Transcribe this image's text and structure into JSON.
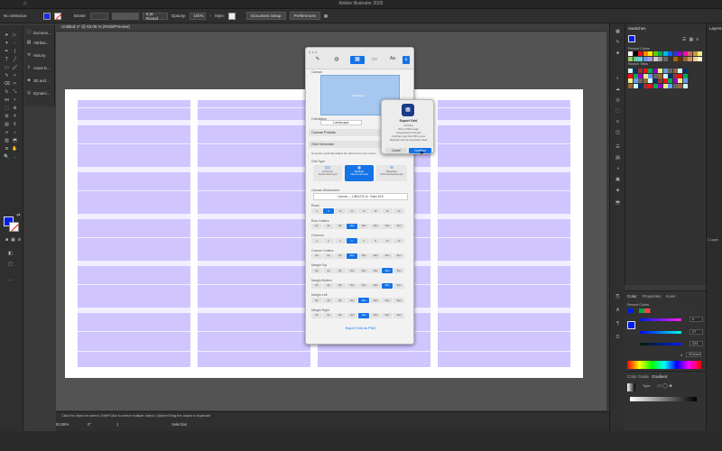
{
  "app": {
    "title": "Adobe Illustrator 2025"
  },
  "control_bar": {
    "selection": "No Selection",
    "stroke_label": "Stroke:",
    "brush": "5 pt. Round",
    "opacity_label": "Opacity:",
    "opacity_value": "100%",
    "style_label": "Style:",
    "document_setup": "Document Setup",
    "preferences": "Preferences"
  },
  "left_panels": {
    "items": [
      "Docume...",
      "Attribut...",
      "History",
      "Asset E...",
      "3D and ...",
      "Dynami..."
    ]
  },
  "document": {
    "tab": "Untitled-1* @ 83.06 % (RGB/Preview)"
  },
  "plugin": {
    "preview_text": "Grid Setup",
    "canvas_label": "Canvas",
    "orientation_label": "Orientation",
    "orientation_value": "Landscape",
    "canvas_presets": "Canvas Presets",
    "grid_generator": "Grid Generator",
    "grid_desc": "Generate a grid that adapts the document to any screen",
    "grid_type_label": "Grid Type",
    "grid_types": [
      {
        "title": "Columns",
        "desc": "Vertical column grid"
      },
      {
        "title": "Modular",
        "desc": "Columns and rows"
      },
      {
        "title": "Baseline",
        "desc": "Horizontal baseline grid"
      }
    ],
    "canvas_dims_label": "Canvas Dimensions",
    "canvas_dims": "Canvas — 1280x720 pt · Ratio 16:9",
    "sections": [
      {
        "label": "Rows",
        "values": [
          "6",
          "8",
          "10",
          "12",
          "14",
          "16",
          "18",
          "20"
        ],
        "selected": 1
      },
      {
        "label": "Row Gutters",
        "values": [
          "0pt",
          "4pt",
          "8pt",
          "12pt",
          "16pt",
          "20pt",
          "24pt",
          "32pt"
        ],
        "selected": 3
      },
      {
        "label": "Columns",
        "values": [
          "2",
          "3",
          "4",
          "5",
          "6",
          "8",
          "10",
          "12"
        ],
        "selected": 3
      },
      {
        "label": "Column Gutters",
        "values": [
          "0pt",
          "4pt",
          "8pt",
          "12pt",
          "16pt",
          "20pt",
          "24pt",
          "32pt"
        ],
        "selected": 3
      },
      {
        "label": "Margin Top",
        "values": [
          "0pt",
          "4pt",
          "8pt",
          "12pt",
          "16pt",
          "20pt",
          "24pt",
          "32pt"
        ],
        "selected": 6
      },
      {
        "label": "Margin Bottom",
        "values": [
          "0pt",
          "4pt",
          "8pt",
          "12pt",
          "16pt",
          "20pt",
          "24pt",
          "32pt"
        ],
        "selected": 6
      },
      {
        "label": "Margin Left",
        "values": [
          "0pt",
          "4pt",
          "8pt",
          "12pt",
          "16pt",
          "20pt",
          "24pt",
          "32pt"
        ],
        "selected": 4
      },
      {
        "label": "Margin Right",
        "values": [
          "0pt",
          "4pt",
          "8pt",
          "12pt",
          "16pt",
          "20pt",
          "24pt",
          "32pt"
        ],
        "selected": 4
      }
    ],
    "export_label": "Export Grid as PNG"
  },
  "dialog": {
    "title": "Export Grid",
    "line1": "Grid.png",
    "line2": "Save a PNG image",
    "line3": "(transparent) of the grid",
    "line4": "It will then copy this PNG to your",
    "line5": "clipboard, and you can paste it back",
    "cancel": "Cancel",
    "continue": "Continue"
  },
  "swatches": {
    "title": "Swatches",
    "recent": "Recent Colors",
    "search": "Search Titles"
  },
  "layers": {
    "title": "Layers",
    "count": "1 Layer"
  },
  "color_panel": {
    "tabs": [
      "Color",
      "Properties",
      "Kuler"
    ],
    "recent": "Recent Colors",
    "values": [
      "0",
      "27",
      "224"
    ],
    "hex": "001bed"
  },
  "guide_panel": {
    "tabs": [
      "Color Guide",
      "Gradient"
    ],
    "type_label": "Type:"
  },
  "status": {
    "hint": "Click the object to select  |  Shift+Click to select multiple object  |  Option+Drag the object to duplicate",
    "zoom": "83.06%",
    "angle": "0°",
    "artboard": "1",
    "mode": "Selection"
  },
  "colors": {
    "accent": "#1473e6",
    "grid": "#aa96ff",
    "fill": "#001bed"
  }
}
